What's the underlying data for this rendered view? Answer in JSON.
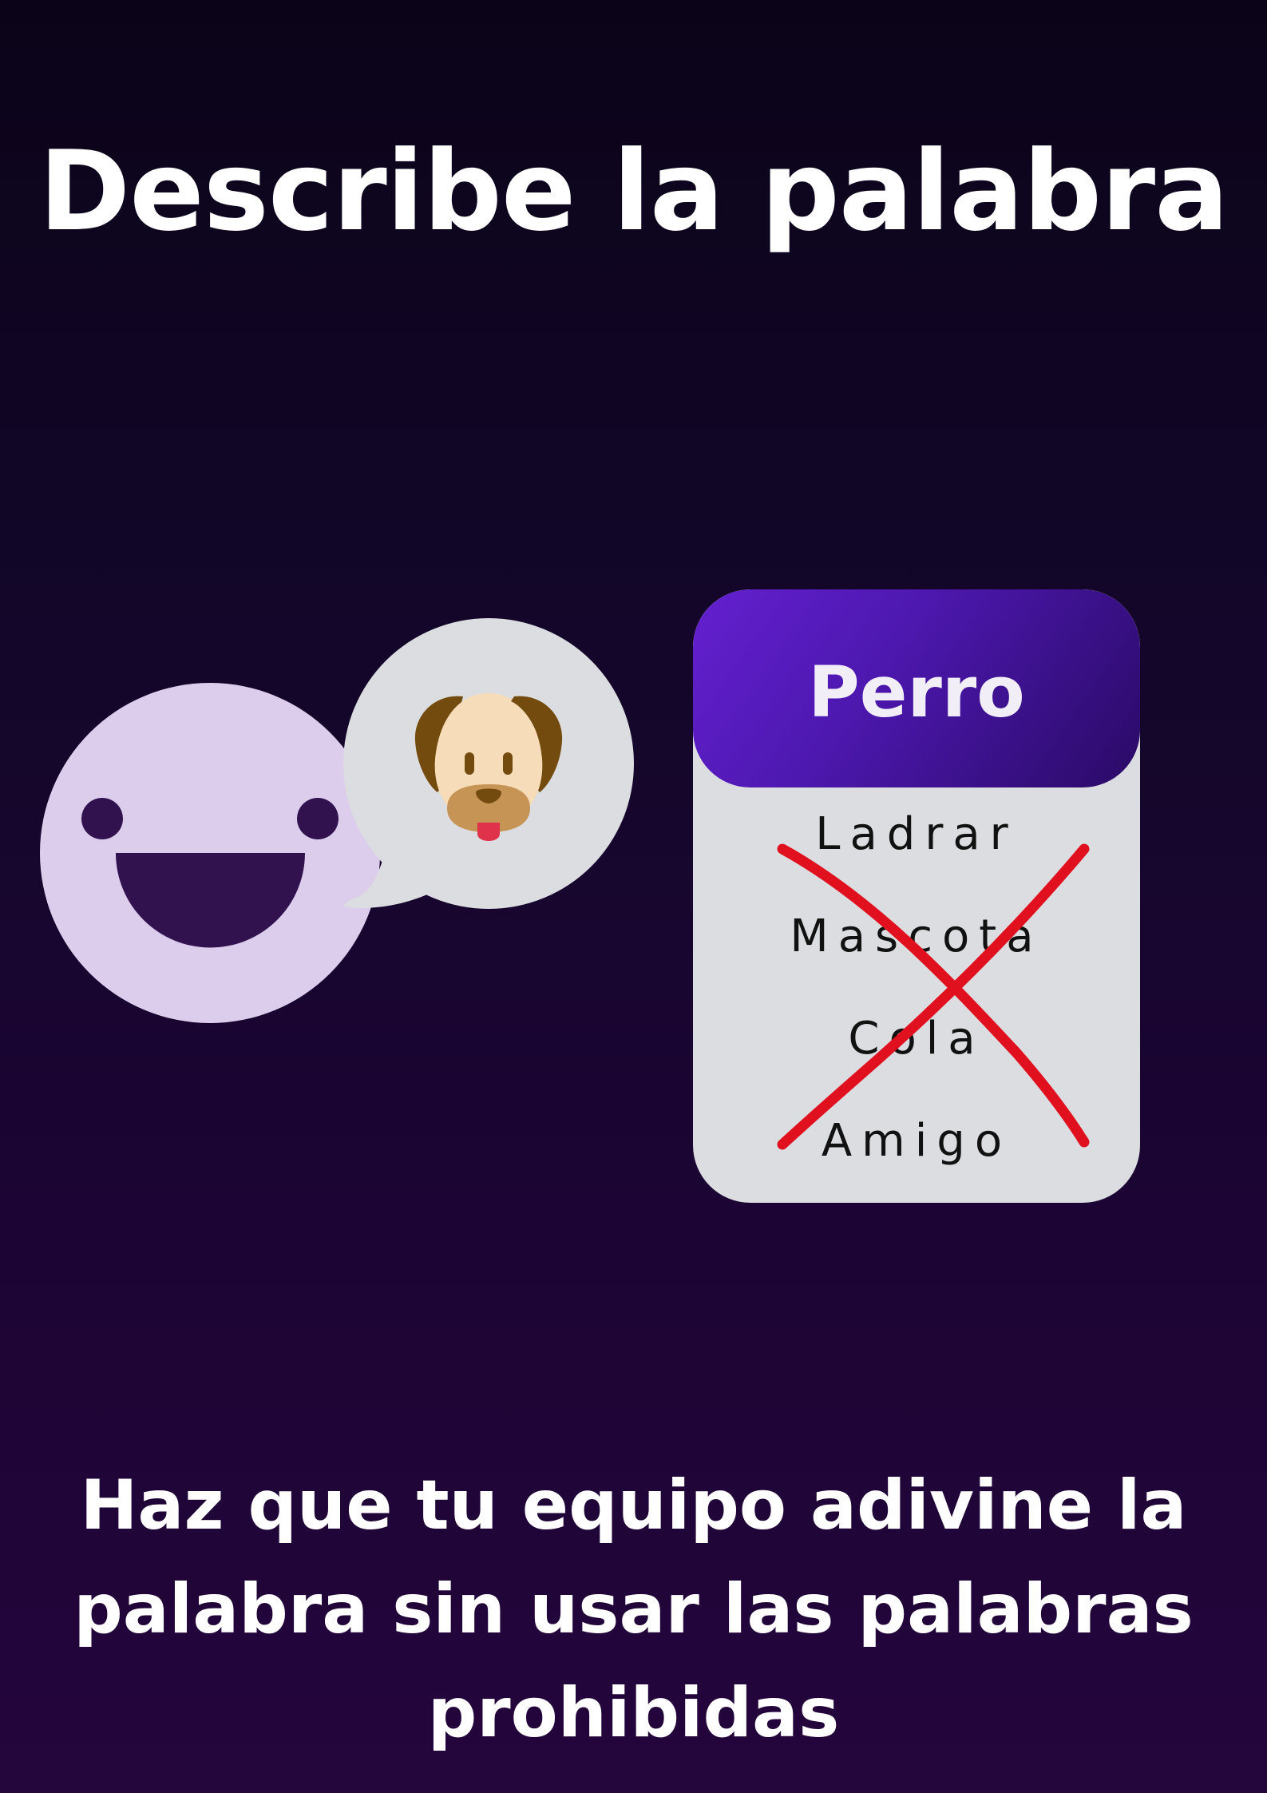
{
  "title": "Describe la palabra",
  "card": {
    "word": "Perro",
    "forbidden_words": [
      "Ladrar",
      "Mascota",
      "Cola",
      "Amigo"
    ]
  },
  "instruction": "Haz que tu equipo adivine la palabra sin usar las palabras prohibidas",
  "icons": {
    "face": "smiling-face-icon",
    "bubble": "speech-bubble-icon",
    "dog": "dog-face-icon",
    "cross": "red-cross-mark-icon"
  },
  "colors": {
    "background_top": "#0b0418",
    "background_bottom": "#24053c",
    "face": "#dccdec",
    "face_features": "#31124f",
    "bubble": "#dcdde0",
    "card_header": "#5a1cc4",
    "card_body": "#dcdde0",
    "cross": "#e0101e"
  }
}
